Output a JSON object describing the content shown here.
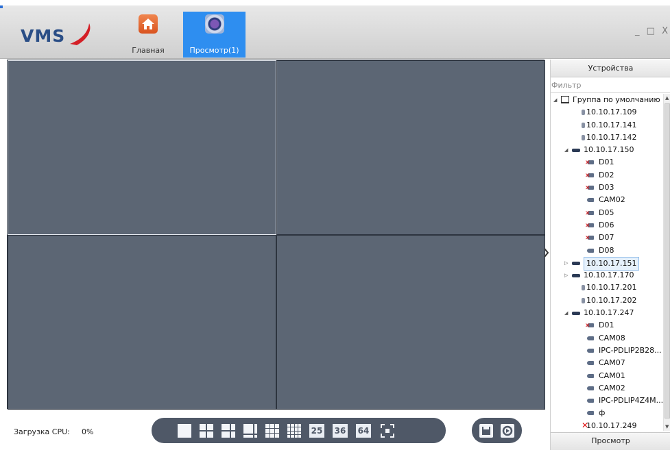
{
  "app": {
    "logo": "VMS",
    "tabs": [
      {
        "label": "Главная",
        "icon": "home-icon"
      },
      {
        "label": "Просмотр(1)",
        "icon": "camera-lens-icon"
      }
    ],
    "window_controls": "_ □ X"
  },
  "status": {
    "cpu_label": "Загрузка CPU:",
    "cpu_value": "0%"
  },
  "layout_buttons": [
    {
      "icon": "layout-1-icon"
    },
    {
      "icon": "layout-4-icon"
    },
    {
      "icon": "layout-6-icon"
    },
    {
      "icon": "layout-8-icon"
    },
    {
      "icon": "layout-9-icon"
    },
    {
      "icon": "layout-16-icon"
    },
    {
      "label": "25"
    },
    {
      "label": "36"
    },
    {
      "label": "64"
    },
    {
      "icon": "fullscreen-icon"
    }
  ],
  "action_buttons": [
    {
      "icon": "save-icon"
    },
    {
      "icon": "record-playback-icon"
    }
  ],
  "panel": {
    "header": "Устройства",
    "filter_placeholder": "Фильтр",
    "footer": "Просмотр",
    "tree": [
      {
        "level": 0,
        "type": "group",
        "expander": "expanded",
        "label": "Группа по умолчанию"
      },
      {
        "level": 1,
        "type": "single",
        "label": "10.10.17.109"
      },
      {
        "level": 1,
        "type": "single",
        "label": "10.10.17.141"
      },
      {
        "level": 1,
        "type": "single",
        "label": "10.10.17.142"
      },
      {
        "level": 1,
        "type": "device",
        "expander": "expanded",
        "label": "10.10.17.150"
      },
      {
        "level": 2,
        "type": "cam-off",
        "label": "D01"
      },
      {
        "level": 2,
        "type": "cam-off",
        "label": "D02"
      },
      {
        "level": 2,
        "type": "cam-off",
        "label": "D03"
      },
      {
        "level": 2,
        "type": "cam",
        "label": "CAM02"
      },
      {
        "level": 2,
        "type": "cam-off",
        "label": "D05"
      },
      {
        "level": 2,
        "type": "cam-off",
        "label": "D06"
      },
      {
        "level": 2,
        "type": "cam-off",
        "label": "D07"
      },
      {
        "level": 2,
        "type": "cam",
        "label": "D08"
      },
      {
        "level": 1,
        "type": "device",
        "expander": "collapsed",
        "label": "10.10.17.151",
        "selected": true
      },
      {
        "level": 1,
        "type": "device",
        "expander": "collapsed",
        "label": "10.10.17.170"
      },
      {
        "level": 1,
        "type": "single",
        "label": "10.10.17.201"
      },
      {
        "level": 1,
        "type": "single",
        "label": "10.10.17.202"
      },
      {
        "level": 1,
        "type": "device",
        "expander": "expanded",
        "label": "10.10.17.247"
      },
      {
        "level": 2,
        "type": "cam-off",
        "label": "D01"
      },
      {
        "level": 2,
        "type": "cam",
        "label": "CAM08"
      },
      {
        "level": 2,
        "type": "cam",
        "label": "IPC-PDLIP2B28..."
      },
      {
        "level": 2,
        "type": "cam",
        "label": "CAM07"
      },
      {
        "level": 2,
        "type": "cam",
        "label": "CAM01"
      },
      {
        "level": 2,
        "type": "cam",
        "label": "CAM02"
      },
      {
        "level": 2,
        "type": "cam",
        "label": "IPC-PDLIP4Z4M..."
      },
      {
        "level": 2,
        "type": "cam",
        "label": "ф"
      },
      {
        "level": 1,
        "type": "error",
        "label": "10.10.17.249"
      }
    ]
  },
  "colors": {
    "video_bg": "#5c6674",
    "active_tab": "#2e8ef0",
    "toolbar_bg": "#4f5867"
  }
}
